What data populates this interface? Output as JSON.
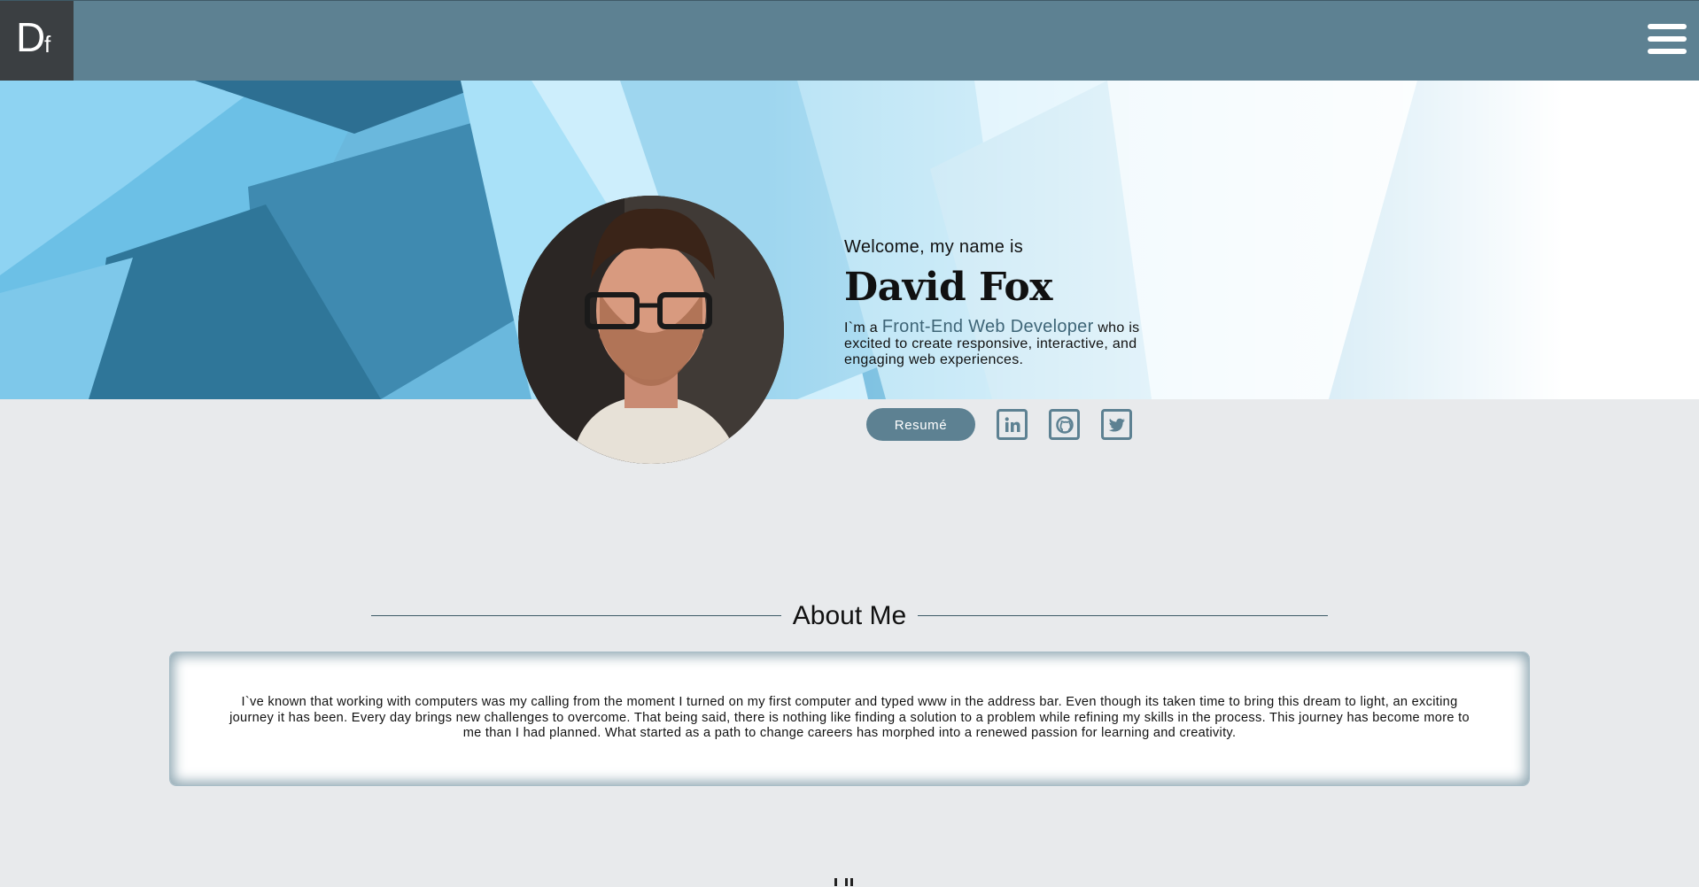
{
  "header": {
    "logo": {
      "big": "D",
      "small": "f"
    },
    "menu_icon": "hamburger-menu-icon"
  },
  "hero": {
    "welcome": "Welcome, my name is",
    "name": "David Fox",
    "tagline_prefix": "I`m a ",
    "role": "Front-End Web Developer",
    "tagline_suffix": " who is excited to create responsive, interactive, and engaging web experiences.",
    "resume_label": "Resumé",
    "social": [
      "linkedin-icon",
      "github-icon",
      "twitter-icon"
    ]
  },
  "about": {
    "title": "About Me",
    "text": "I`ve known that working with computers was my calling from the moment I turned on my first computer and typed www in the address bar. Even though its taken time to bring this dream to light, an exciting journey it has been. Every day brings new challenges to overcome. That being said, there is nothing like finding a solution to a problem while refining my skills in the process. This journey has become more to me than I had planned. What started as a path to change careers has morphed into a renewed passion for learning and creativity."
  },
  "colors": {
    "header": "#5d8192",
    "logo_bg": "#3b3f42",
    "page_bg": "#e8eaec",
    "accent_text": "#3e6577"
  }
}
